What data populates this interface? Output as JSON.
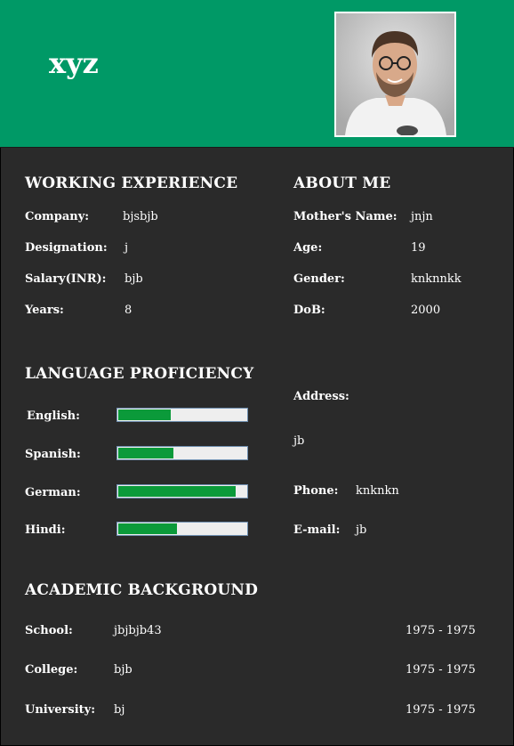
{
  "header": {
    "name": "xyz"
  },
  "work": {
    "title": "WORKING EXPERIENCE",
    "company_label": "Company:",
    "company": "bjsbjb",
    "designation_label": "Designation:",
    "designation": "j",
    "salary_label": "Salary(INR):",
    "salary": "bjb",
    "years_label": "Years:",
    "years": "8"
  },
  "about": {
    "title": "ABOUT ME",
    "mother_label": "Mother's Name:",
    "mother": "jnjn",
    "age_label": "Age:",
    "age": "19",
    "gender_label": "Gender:",
    "gender": "knknnkk",
    "dob_label": "DoB:",
    "dob": "2000",
    "address_label": "Address:",
    "address": "jb",
    "phone_label": "Phone:",
    "phone": "knknkn",
    "email_label": "E-mail:",
    "email": "jb"
  },
  "languages": {
    "title": "LANGUAGE PROFICIENCY",
    "items": [
      {
        "label": "English:",
        "level": 0.41
      },
      {
        "label": "Spanish:",
        "level": 0.43
      },
      {
        "label": "German:",
        "level": 0.92
      },
      {
        "label": "Hindi:",
        "level": 0.46
      }
    ]
  },
  "academic": {
    "title": "ACADEMIC BACKGROUND",
    "rows": [
      {
        "label": "School:",
        "name": "jbjbjb43",
        "years": "1975 - 1975"
      },
      {
        "label": "College:",
        "name": "bjb",
        "years": "1975 - 1975"
      },
      {
        "label": "University:",
        "name": "bj",
        "years": "1975 - 1975"
      }
    ]
  },
  "colors": {
    "header": "#009966",
    "background": "#2a2a2a",
    "bar_fill": "#0b9a3a"
  }
}
